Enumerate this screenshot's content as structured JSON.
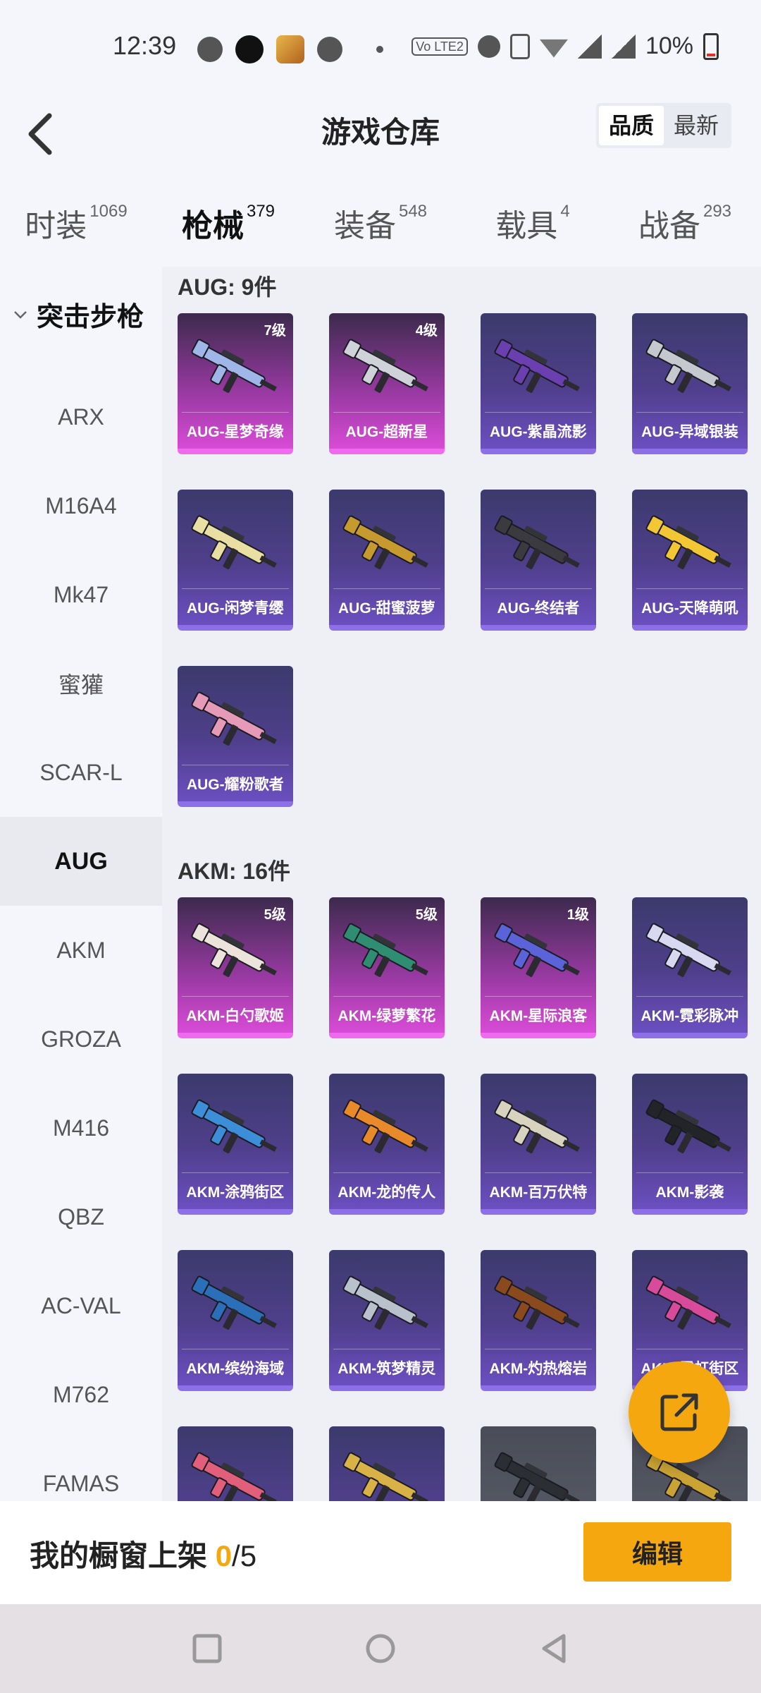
{
  "status_bar": {
    "time": "12:39",
    "volte": "Vo LTE2",
    "battery_text": "10%"
  },
  "header": {
    "title": "游戏仓库",
    "sort_options": [
      "品质",
      "最新"
    ],
    "sort_active": "品质"
  },
  "tabs": [
    {
      "label": "时装",
      "count": "1069",
      "active": false
    },
    {
      "label": "枪械",
      "count": "379",
      "active": true
    },
    {
      "label": "装备",
      "count": "548",
      "active": false
    },
    {
      "label": "载具",
      "count": "4",
      "active": false
    },
    {
      "label": "战备",
      "count": "293",
      "active": false
    }
  ],
  "sidebar": {
    "category": "突击步枪",
    "items": [
      {
        "label": "ARX"
      },
      {
        "label": "M16A4"
      },
      {
        "label": "Mk47"
      },
      {
        "label": "蜜獾"
      },
      {
        "label": "SCAR-L"
      },
      {
        "label": "AUG"
      },
      {
        "label": "AKM"
      },
      {
        "label": "GROZA"
      },
      {
        "label": "M416"
      },
      {
        "label": "QBZ"
      },
      {
        "label": "AC-VAL"
      },
      {
        "label": "M762"
      },
      {
        "label": "FAMAS"
      }
    ],
    "active": "AUG"
  },
  "sections": [
    {
      "title": "AUG: 9件",
      "items": [
        {
          "name": "AUG-星梦奇缘",
          "level": "7级",
          "quality": "pink",
          "color": "#9fb6e8"
        },
        {
          "name": "AUG-超新星",
          "level": "4级",
          "quality": "pink",
          "color": "#cfd2d8"
        },
        {
          "name": "AUG-紫晶流影",
          "level": "",
          "quality": "purple",
          "color": "#6a3fb0"
        },
        {
          "name": "AUG-异域银装",
          "level": "",
          "quality": "purple",
          "color": "#c5c8cf"
        },
        {
          "name": "AUG-闲梦青缨",
          "level": "",
          "quality": "purple",
          "color": "#e9dfa2"
        },
        {
          "name": "AUG-甜蜜菠萝",
          "level": "",
          "quality": "purple",
          "color": "#c79a2f"
        },
        {
          "name": "AUG-终结者",
          "level": "",
          "quality": "purple",
          "color": "#3b3b3f"
        },
        {
          "name": "AUG-天降萌吼",
          "level": "",
          "quality": "purple",
          "color": "#f3c634"
        },
        {
          "name": "AUG-耀粉歌者",
          "level": "",
          "quality": "purple",
          "color": "#e59ab8"
        }
      ]
    },
    {
      "title": "AKM: 16件",
      "items": [
        {
          "name": "AKM-白勺歌姬",
          "level": "5级",
          "quality": "pink",
          "color": "#ece4da"
        },
        {
          "name": "AKM-绿萝繁花",
          "level": "5级",
          "quality": "pink",
          "color": "#2f8e72"
        },
        {
          "name": "AKM-星际浪客",
          "level": "1级",
          "quality": "pink",
          "color": "#5a64d8"
        },
        {
          "name": "AKM-霓彩脉冲",
          "level": "",
          "quality": "purple",
          "color": "#d8d8f0"
        },
        {
          "name": "AKM-涂鸦街区",
          "level": "",
          "quality": "purple",
          "color": "#3c8ed8"
        },
        {
          "name": "AKM-龙的传人",
          "level": "",
          "quality": "purple",
          "color": "#e88a2a"
        },
        {
          "name": "AKM-百万伏特",
          "level": "",
          "quality": "purple",
          "color": "#d7d3bf"
        },
        {
          "name": "AKM-影袭",
          "level": "",
          "quality": "purple",
          "color": "#222428"
        },
        {
          "name": "AKM-缤纷海域",
          "level": "",
          "quality": "purple",
          "color": "#2a6fb8"
        },
        {
          "name": "AKM-筑梦精灵",
          "level": "",
          "quality": "purple",
          "color": "#b9c2cc"
        },
        {
          "name": "AKM-灼热熔岩",
          "level": "",
          "quality": "purple",
          "color": "#8a4a1e"
        },
        {
          "name": "AKM-霓虹街区",
          "level": "",
          "quality": "purple",
          "color": "#d84b9b"
        },
        {
          "name": "",
          "level": "",
          "quality": "purple",
          "color": "#e25f7b"
        },
        {
          "name": "",
          "level": "",
          "quality": "purple",
          "color": "#d9b247"
        },
        {
          "name": "",
          "level": "",
          "quality": "grey",
          "color": "#2b2e33"
        },
        {
          "name": "",
          "level": "",
          "quality": "grey",
          "color": "#c9a334"
        }
      ]
    }
  ],
  "bottom": {
    "showcase_label": "我的橱窗上架",
    "showcase_count": "0",
    "showcase_total": "/5",
    "edit_label": "编辑"
  },
  "icons": {
    "back": "chevron-left-icon",
    "share": "share-external-icon",
    "chevron": "chevron-down-icon"
  },
  "colors": {
    "accent": "#f5a70f",
    "purple_quality": "#8d70e8",
    "pink_quality": "#f06af0"
  }
}
